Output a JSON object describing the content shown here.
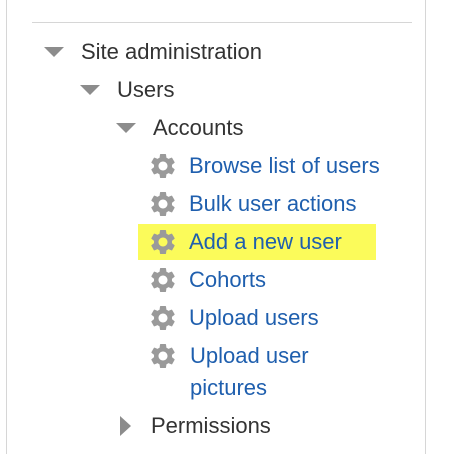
{
  "tree": {
    "site_admin": {
      "label": "Site administration",
      "expanded": true
    },
    "users": {
      "label": "Users",
      "expanded": true
    },
    "accounts": {
      "label": "Accounts",
      "expanded": true
    },
    "links": [
      {
        "label": "Browse list of users",
        "icon": "gear-icon"
      },
      {
        "label": "Bulk user actions",
        "icon": "gear-icon"
      },
      {
        "label": "Add a new user",
        "icon": "gear-icon",
        "highlighted": true
      },
      {
        "label": "Cohorts",
        "icon": "gear-icon"
      },
      {
        "label": "Upload users",
        "icon": "gear-icon"
      }
    ],
    "upload_pictures": {
      "line1": "Upload user",
      "line2": "pictures",
      "icon": "gear-icon"
    },
    "permissions": {
      "label": "Permissions",
      "expanded": false
    }
  },
  "colors": {
    "link": "#1f5fae",
    "text": "#333333",
    "highlight": "#fbfb5a",
    "triangle": "#8c8c8c",
    "gear": "#9a9a9a"
  }
}
